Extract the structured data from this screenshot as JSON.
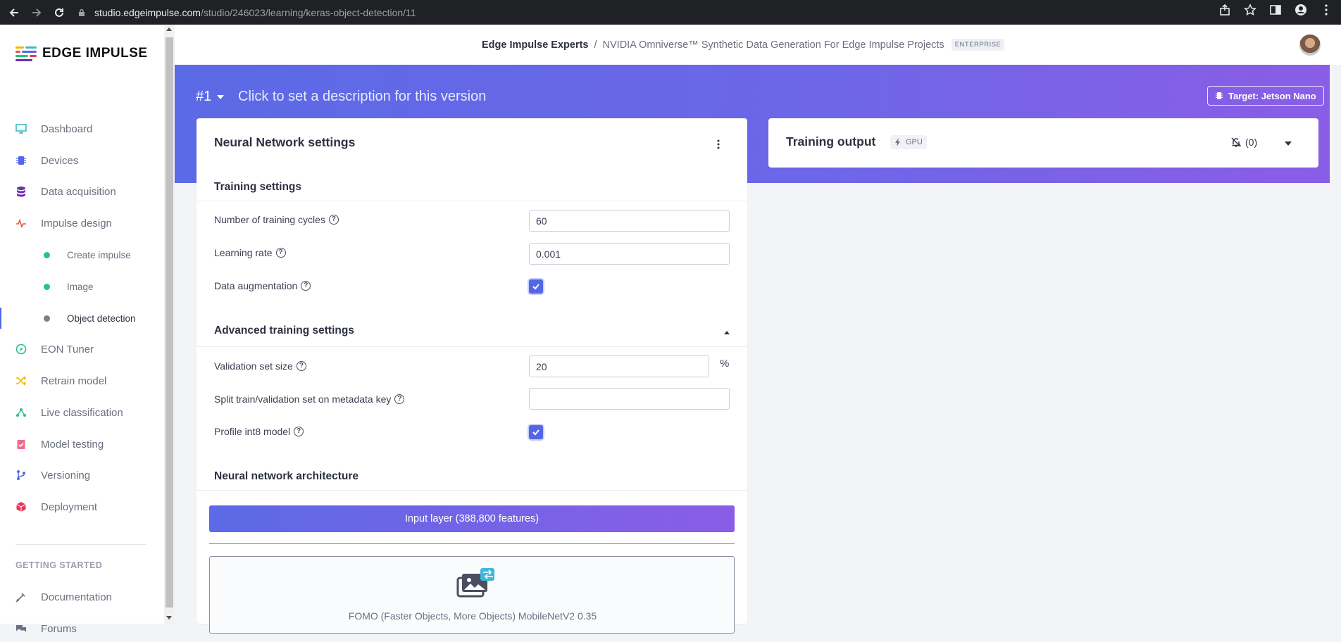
{
  "browser": {
    "url_host": "studio.edgeimpulse.com",
    "url_path": "/studio/246023/learning/keras-object-detection/11"
  },
  "sidebar": {
    "logo_text": "EDGE IMPULSE",
    "items": [
      {
        "label": "Dashboard",
        "icon": "monitor-icon",
        "color": "#3fb8c9"
      },
      {
        "label": "Devices",
        "icon": "chip-icon",
        "color": "#5367e6"
      },
      {
        "label": "Data acquisition",
        "icon": "database-icon",
        "color": "#6b2fa8"
      },
      {
        "label": "Impulse design",
        "icon": "pulse-icon",
        "color": "#e8553f"
      }
    ],
    "sub_items": [
      {
        "label": "Create impulse",
        "dot_color": "#26c281"
      },
      {
        "label": "Image",
        "dot_color": "#26c281"
      },
      {
        "label": "Object detection",
        "dot_color": "#7b7f90"
      }
    ],
    "items2": [
      {
        "label": "EON Tuner",
        "icon": "compass-icon",
        "color": "#26c281"
      },
      {
        "label": "Retrain model",
        "icon": "shuffle-icon",
        "color": "#f2b705"
      },
      {
        "label": "Live classification",
        "icon": "graph-icon",
        "color": "#26c281"
      },
      {
        "label": "Model testing",
        "icon": "clipboard-check-icon",
        "color": "#f06b8a"
      },
      {
        "label": "Versioning",
        "icon": "branch-icon",
        "color": "#5367e6"
      },
      {
        "label": "Deployment",
        "icon": "cube-icon",
        "color": "#e8365a"
      }
    ],
    "section_heading": "GETTING STARTED",
    "items3": [
      {
        "label": "Documentation",
        "icon": "doc-icon",
        "color": "#6b6f80"
      },
      {
        "label": "Forums",
        "icon": "comments-icon",
        "color": "#6b6f80"
      }
    ]
  },
  "header": {
    "crumb_org": "Edge Impulse Experts",
    "crumb_sep": "/",
    "crumb_project": "NVIDIA Omniverse™ Synthetic Data Generation For Edge Impulse Projects",
    "badge": "ENTERPRISE"
  },
  "banner": {
    "version": "#1",
    "description": "Click to set a description for this version",
    "target_label": "Target: Jetson Nano"
  },
  "nn_settings": {
    "title": "Neural Network settings",
    "training_settings_heading": "Training settings",
    "training_cycles_label": "Number of training cycles",
    "training_cycles_value": "60",
    "learning_rate_label": "Learning rate",
    "learning_rate_value": "0.001",
    "data_augmentation_label": "Data augmentation",
    "advanced_heading": "Advanced training settings",
    "validation_label": "Validation set size",
    "validation_value": "20",
    "validation_unit": "%",
    "split_label": "Split train/validation set on metadata key",
    "split_value": "",
    "profile_label": "Profile int8 model",
    "architecture_heading": "Neural network architecture",
    "input_layer": "Input layer (388,800 features)",
    "model_name": "FOMO (Faster Objects, More Objects) MobileNetV2 0.35"
  },
  "training_output": {
    "title": "Training output",
    "gpu_badge": "GPU",
    "notifications": "(0)"
  },
  "colors": {
    "accent": "#5367e6",
    "banner_start": "#5b6ae6",
    "banner_end": "#8b5de6"
  }
}
